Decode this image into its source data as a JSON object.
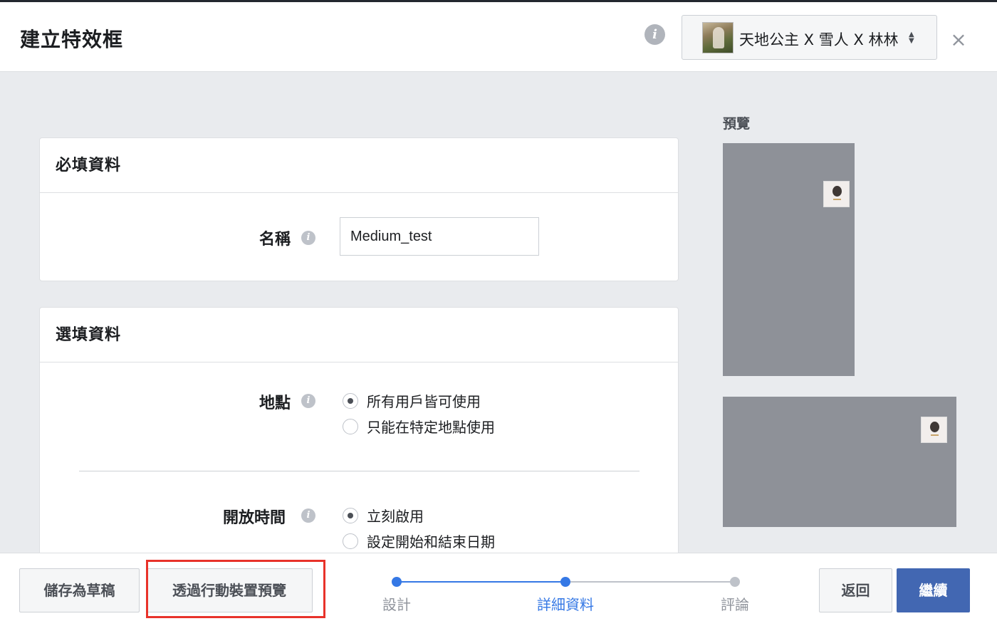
{
  "header": {
    "title": "建立特效框",
    "page_name": "天地公主 X 雪人 X 林林"
  },
  "required": {
    "heading": "必填資料",
    "name_label": "名稱",
    "name_value": "Medium_test"
  },
  "optional": {
    "heading": "選填資料",
    "location_label": "地點",
    "location_options": [
      "所有用戶皆可使用",
      "只能在特定地點使用"
    ],
    "location_selected": 0,
    "schedule_label": "開放時間",
    "schedule_options": [
      "立刻啟用",
      "設定開始和結束日期"
    ],
    "schedule_selected": 0
  },
  "preview": {
    "title": "預覽"
  },
  "footer": {
    "save_draft": "儲存為草稿",
    "mobile_preview": "透過行動裝置預覽",
    "steps": [
      {
        "label": "設計",
        "state": "done"
      },
      {
        "label": "詳細資料",
        "state": "current"
      },
      {
        "label": "評論",
        "state": "todo"
      }
    ],
    "back": "返回",
    "continue": "繼續"
  },
  "colors": {
    "accent": "#4267b2",
    "step_active": "#3578e5",
    "step_inactive": "#bec2c9",
    "highlight": "#e8322a"
  },
  "icons": {
    "info": "info-icon",
    "close": "close-icon",
    "sort": "sort-arrows-icon"
  }
}
